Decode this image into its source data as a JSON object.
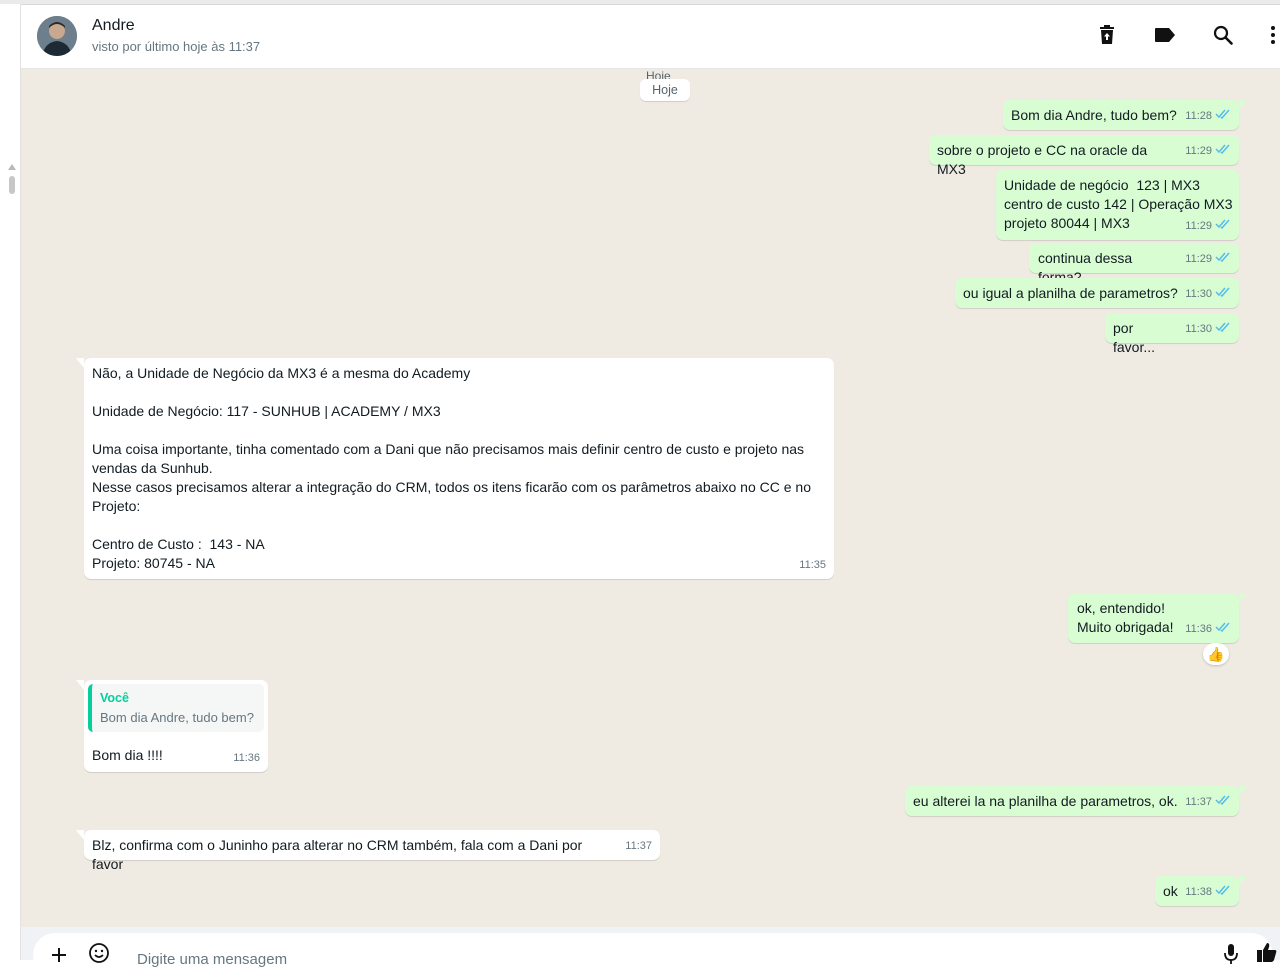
{
  "header": {
    "contact_name": "Andre",
    "last_seen": "visto por último hoje às 11:37",
    "icons": [
      "trash-icon",
      "label-icon",
      "search-icon",
      "more-vertical-icon"
    ]
  },
  "chat": {
    "date_ghost": "Hoje",
    "date_label": "Hoje",
    "messages": [
      {
        "dir": "out",
        "text": "Bom dia Andre, tudo bem?",
        "time": "11:28"
      },
      {
        "dir": "out",
        "text": "sobre o projeto e CC na oracle da MX3",
        "time": "11:29"
      },
      {
        "dir": "out",
        "text": "Unidade de negócio  123 | MX3\ncentro de custo 142 | Operação MX3\nprojeto 80044 | MX3",
        "time": "11:29"
      },
      {
        "dir": "out",
        "text": "continua dessa forma?",
        "time": "11:29"
      },
      {
        "dir": "out",
        "text": "ou igual a planilha de parametros?",
        "time": "11:30"
      },
      {
        "dir": "out",
        "text": "por favor...",
        "time": "11:30"
      },
      {
        "dir": "in",
        "text": "Não, a Unidade de Negócio da MX3 é a mesma do Academy\n\nUnidade de Negócio: 117 - SUNHUB | ACADEMY / MX3\n\nUma coisa importante, tinha comentado com a Dani que não precisamos mais definir centro de custo e projeto nas vendas da Sunhub.\nNesse casos precisamos alterar a integração do CRM, todos os itens ficarão com os parâmetros abaixo no CC e no Projeto:\n\nCentro de Custo :  143 - NA\nProjeto: 80745 - NA",
        "time": "11:35"
      },
      {
        "dir": "out",
        "text": "ok, entendido!\nMuito obrigada!",
        "time": "11:36",
        "reaction": "👍"
      },
      {
        "dir": "in",
        "text": "Bom dia !!!!",
        "time": "11:36",
        "quote": {
          "author": "Você",
          "text": "Bom dia Andre, tudo bem?"
        }
      },
      {
        "dir": "out",
        "text": "eu alterei la na planilha de parametros, ok.",
        "time": "11:37"
      },
      {
        "dir": "in",
        "text": "Blz, confirma com o Juninho para alterar no CRM também, fala com a Dani por favor",
        "time": "11:37"
      },
      {
        "dir": "out",
        "text": "ok",
        "time": "11:38"
      }
    ]
  },
  "composer": {
    "placeholder": "Digite uma mensagem",
    "icons": [
      "plus-icon",
      "sticker-icon",
      "microphone-icon",
      "like-icon"
    ]
  },
  "colors": {
    "outgoing_bubble": "#d9fdd3",
    "incoming_bubble": "#ffffff",
    "chat_background": "#efeae2",
    "read_ticks": "#53bdeb",
    "quote_accent": "#06cf9c"
  }
}
